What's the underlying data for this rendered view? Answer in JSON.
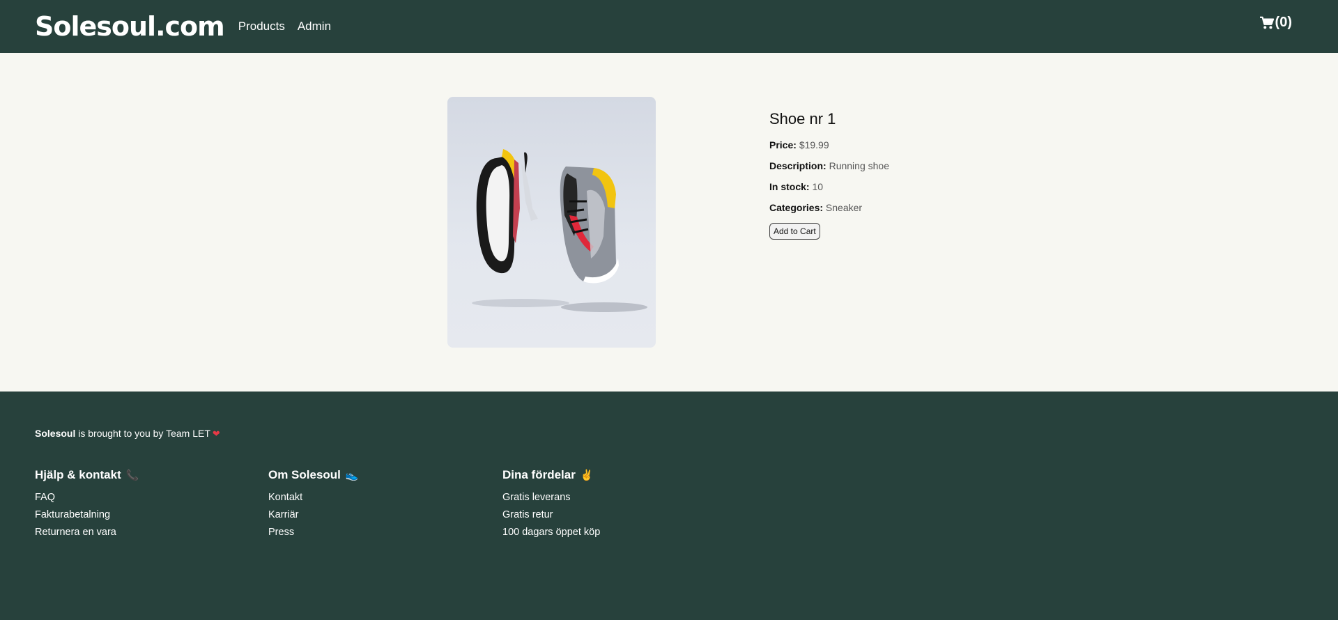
{
  "header": {
    "brand": "Solesoul.com",
    "nav": [
      "Products",
      "Admin"
    ],
    "cart_count_text": "(0)",
    "cart_icon": "shopping-cart-icon"
  },
  "product": {
    "title": "Shoe nr 1",
    "price_label": "Price:",
    "price_value": "$19.99",
    "description_label": "Description:",
    "description_value": "Running shoe",
    "stock_label": "In stock:",
    "stock_value": "10",
    "categories_label": "Categories:",
    "categories_value": "Sneaker",
    "add_button": "Add to Cart"
  },
  "footer": {
    "intro_brand": "Solesoul",
    "intro_text": " is brought to you by Team LET",
    "intro_emoji": "❤",
    "columns": [
      {
        "title": "Hjälp & kontakt",
        "emoji": "📞",
        "links": [
          "FAQ",
          "Fakturabetalning",
          "Returnera en vara"
        ]
      },
      {
        "title": "Om Solesoul",
        "emoji": "👟",
        "links": [
          "Kontakt",
          "Karriär",
          "Press"
        ]
      },
      {
        "title": "Dina fördelar",
        "emoji": "✌",
        "links": [
          "Gratis leverans",
          "Gratis retur",
          "100 dagars öppet köp"
        ]
      }
    ]
  },
  "colors": {
    "header_bg": "#27413c",
    "page_bg": "#f7f7f2",
    "footer_bg": "#27413c"
  }
}
